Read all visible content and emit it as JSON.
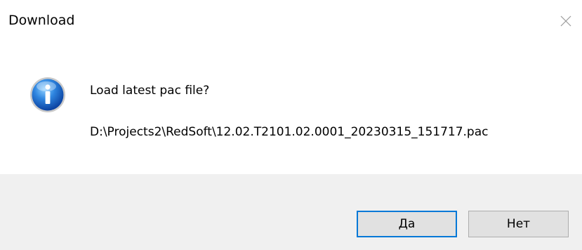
{
  "window": {
    "title": "Download",
    "close_icon": "close-icon"
  },
  "message": {
    "icon": "info-icon",
    "question": "Load latest pac file?",
    "path": "D:\\Projects2\\RedSoft\\12.02.T2101.02.0001_20230315_151717.pac"
  },
  "buttons": {
    "yes_label": "Да",
    "no_label": "Нет"
  },
  "colors": {
    "footer_bg": "#f0f0f0",
    "default_button_border": "#0078d7",
    "icon_blue": "#1f6fd1"
  }
}
